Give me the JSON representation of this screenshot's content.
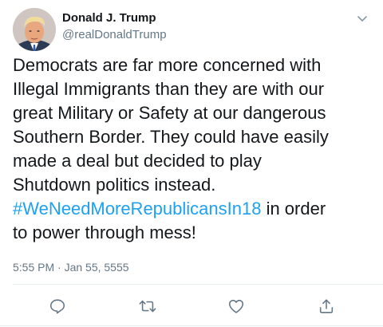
{
  "author": {
    "display_name": "Donald J. Trump",
    "handle": "@realDonaldTrump",
    "avatar_icon": "profile-photo-avatar"
  },
  "tweet": {
    "lines": [
      "Democrats are far more concerned with",
      "Illegal Immigrants than they are with our",
      "great Military or Safety at our dangerous",
      "Southern Border. They could have easily",
      "made a deal but decided to play",
      "Shutdown politics instead."
    ],
    "hashtag": "#WeNeedMoreRepublicansIn18",
    "after_hashtag": " in order",
    "last_line": "to power through mess!"
  },
  "timestamp": "5:55 PM · Jan 55, 5555",
  "actions": {
    "reply_icon": "reply-icon",
    "retweet_icon": "retweet-icon",
    "like_icon": "heart-icon",
    "share_icon": "share-icon"
  },
  "menu_icon": "chevron-down-icon",
  "colors": {
    "text": "#14171a",
    "secondary": "#657786",
    "link": "#1da1f2",
    "divider": "#e6ecf0"
  }
}
